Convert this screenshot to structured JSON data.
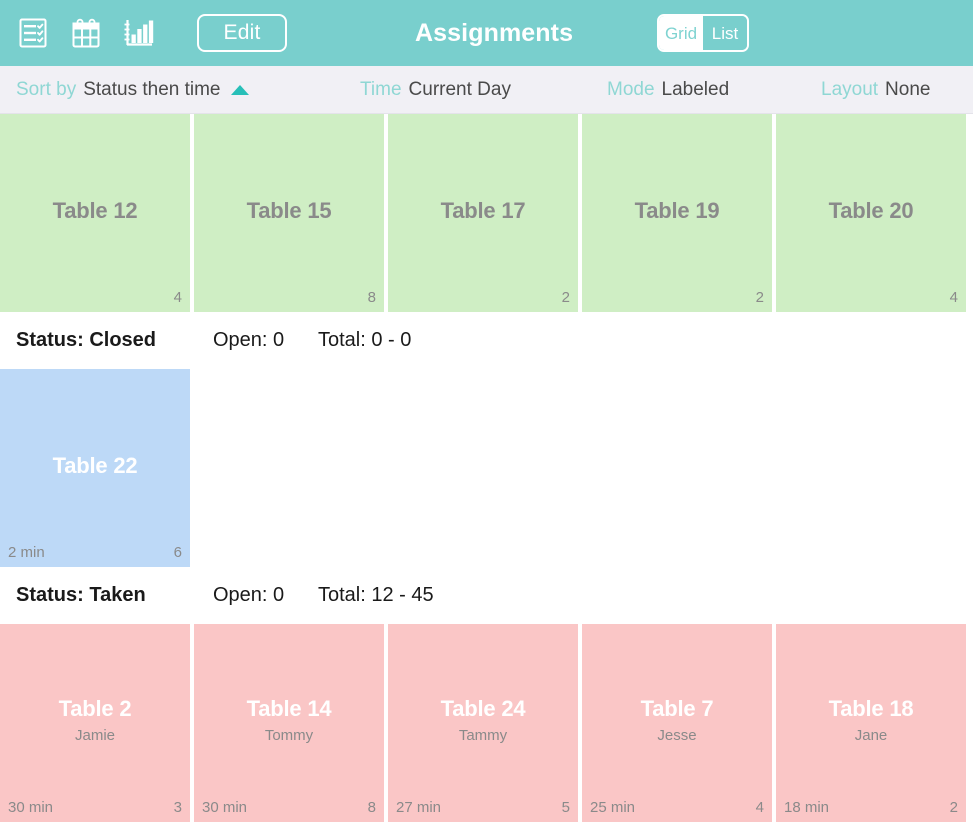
{
  "header": {
    "title": "Assignments",
    "edit_label": "Edit",
    "icons": [
      {
        "name": "checklist-icon"
      },
      {
        "name": "calendar-icon"
      },
      {
        "name": "bar-chart-icon"
      }
    ],
    "view_toggle": {
      "options": [
        "Grid",
        "List"
      ],
      "grid_label": "Grid",
      "list_label": "List",
      "selected": "Grid"
    }
  },
  "filters": [
    {
      "id": "sort",
      "label": "Sort by",
      "value": "Status then time",
      "caret": "up"
    },
    {
      "id": "time",
      "label": "Time",
      "value": "Current Day"
    },
    {
      "id": "mode",
      "label": "Mode",
      "value": "Labeled"
    },
    {
      "id": "layout",
      "label": "Layout",
      "value": "None"
    }
  ],
  "colors": {
    "topbar": "#79cfcd",
    "filterbar": "#f1f0f5",
    "accent_teal": "#8fd7d4",
    "caret_teal": "#27bfb8",
    "card_green": "#cfeec4",
    "card_blue": "#bdd9f7",
    "card_pink": "#fac6c6",
    "muted_text": "#8a8a8a"
  },
  "sections": [
    {
      "id": "section-open",
      "cards": [
        {
          "title": "Table 12",
          "sub": "",
          "time": "",
          "count": "4",
          "color": "green"
        },
        {
          "title": "Table 15",
          "sub": "",
          "time": "",
          "count": "8",
          "color": "green"
        },
        {
          "title": "Table 17",
          "sub": "",
          "time": "",
          "count": "2",
          "color": "green"
        },
        {
          "title": "Table 19",
          "sub": "",
          "time": "",
          "count": "2",
          "color": "green"
        },
        {
          "title": "Table 20",
          "sub": "",
          "time": "",
          "count": "4",
          "color": "green"
        }
      ],
      "summary": {
        "status": "Status: Closed",
        "open": "Open: 0",
        "total": "Total: 0 - 0"
      }
    },
    {
      "id": "section-closed",
      "cards": [
        {
          "title": "Table 22",
          "sub": "",
          "time": "2 min",
          "count": "6",
          "color": "blue"
        }
      ],
      "summary": {
        "status": "Status: Taken",
        "open": "Open: 0",
        "total": "Total: 12 - 45"
      }
    },
    {
      "id": "section-taken",
      "cards": [
        {
          "title": "Table 2",
          "sub": "Jamie",
          "time": "30 min",
          "count": "3",
          "color": "pink"
        },
        {
          "title": "Table 14",
          "sub": "Tommy",
          "time": "30 min",
          "count": "8",
          "color": "pink"
        },
        {
          "title": "Table 24",
          "sub": "Tammy",
          "time": "27 min",
          "count": "5",
          "color": "pink"
        },
        {
          "title": "Table 7",
          "sub": "Jesse",
          "time": "25 min",
          "count": "4",
          "color": "pink"
        },
        {
          "title": "Table 18",
          "sub": "Jane",
          "time": "18 min",
          "count": "2",
          "color": "pink"
        }
      ],
      "summary": null
    }
  ]
}
